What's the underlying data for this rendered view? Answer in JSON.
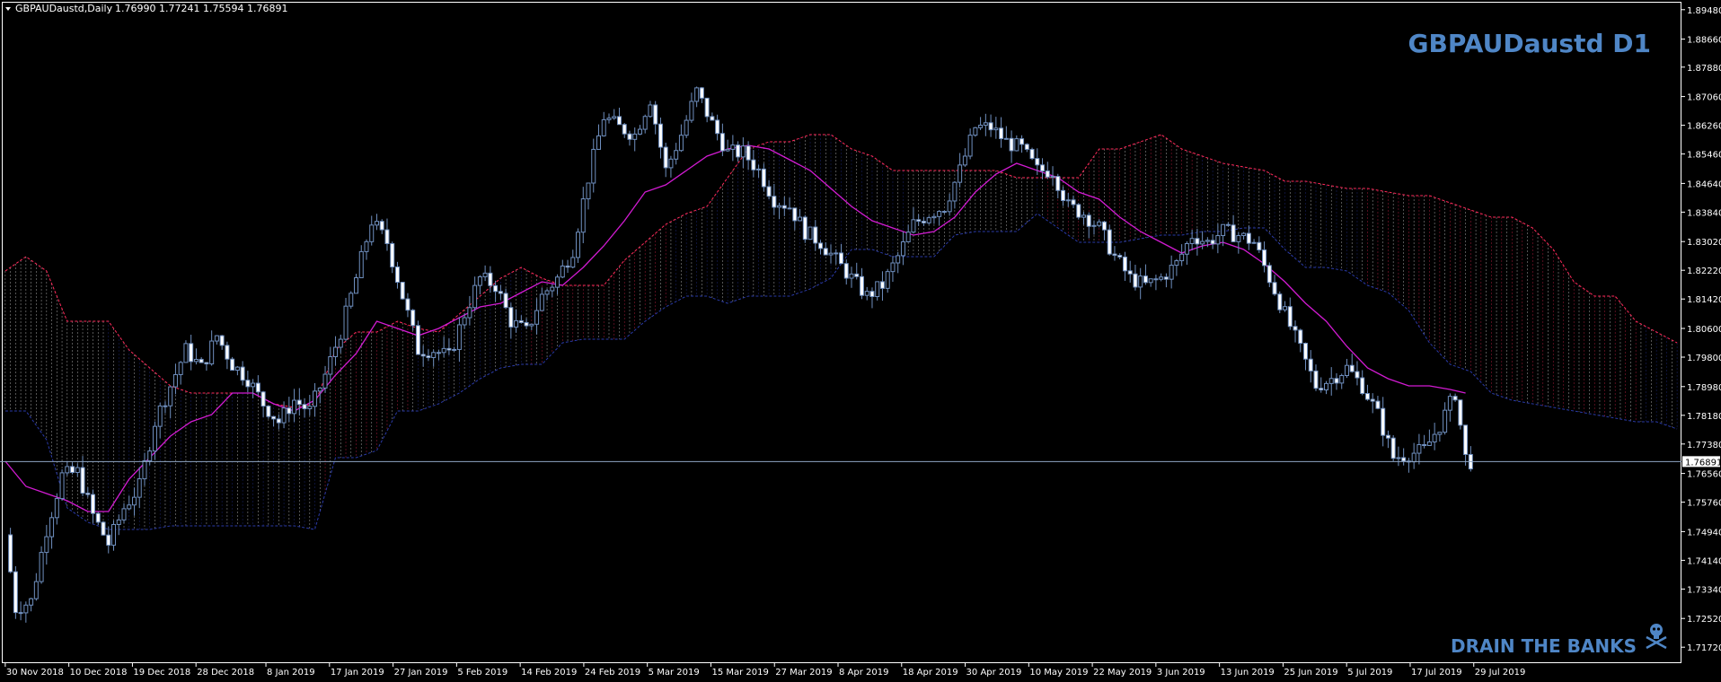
{
  "header": {
    "symbol": "GBPAUDaustd,Daily",
    "ohlc": "1.76990 1.77241 1.75594 1.76891"
  },
  "overlay": {
    "title": "GBPAUDaustd D1",
    "footer": "DRAIN THE BANKS"
  },
  "colors": {
    "background": "#000000",
    "axis": "#ffffff",
    "candle": "#ffffff",
    "wick": "#6f8fbf",
    "price_line": "#8fa6c4",
    "kijun": "#d21bd2",
    "cloud_bull": "#ffffff",
    "cloud_red": "#ff2a5a",
    "cloud_blue": "#2a3aa8",
    "brand": "#4f86c6"
  },
  "chart_data": {
    "type": "candlestick",
    "title": "GBPAUDaustd D1",
    "current_price": "1.76891",
    "ylim": [
      1.714,
      1.8955
    ],
    "y_ticks": [
      "1.89480",
      "1.88660",
      "1.87880",
      "1.87060",
      "1.86260",
      "1.85460",
      "1.84640",
      "1.83840",
      "1.83020",
      "1.82220",
      "1.81420",
      "1.80600",
      "1.79800",
      "1.78980",
      "1.78180",
      "1.77380",
      "1.76560",
      "1.75760",
      "1.74940",
      "1.74140",
      "1.73340",
      "1.72520",
      "1.71720"
    ],
    "x_ticks": [
      "30 Nov 2018",
      "10 Dec 2018",
      "19 Dec 2018",
      "28 Dec 2018",
      "8 Jan 2019",
      "17 Jan 2019",
      "27 Jan 2019",
      "5 Feb 2019",
      "14 Feb 2019",
      "24 Feb 2019",
      "5 Mar 2019",
      "15 Mar 2019",
      "27 Mar 2019",
      "8 Apr 2019",
      "18 Apr 2019",
      "30 Apr 2019",
      "10 May 2019",
      "22 May 2019",
      "3 Jun 2019",
      "13 Jun 2019",
      "25 Jun 2019",
      "5 Jul 2019",
      "17 Jul 2019",
      "29 Jul 2019"
    ],
    "close_path": [
      [
        0,
        1.7485
      ],
      [
        2,
        1.728
      ],
      [
        5,
        1.73
      ],
      [
        8,
        1.75
      ],
      [
        11,
        1.765
      ],
      [
        14,
        1.766
      ],
      [
        17,
        1.754
      ],
      [
        20,
        1.746
      ],
      [
        23,
        1.756
      ],
      [
        26,
        1.762
      ],
      [
        29,
        1.78
      ],
      [
        32,
        1.79
      ],
      [
        35,
        1.8
      ],
      [
        38,
        1.795
      ],
      [
        41,
        1.804
      ],
      [
        44,
        1.796
      ],
      [
        47,
        1.792
      ],
      [
        50,
        1.785
      ],
      [
        53,
        1.78
      ],
      [
        56,
        1.786
      ],
      [
        59,
        1.783
      ],
      [
        62,
        1.793
      ],
      [
        65,
        1.805
      ],
      [
        68,
        1.82
      ],
      [
        71,
        1.836
      ],
      [
        74,
        1.83
      ],
      [
        77,
        1.815
      ],
      [
        80,
        1.8
      ],
      [
        83,
        1.8
      ],
      [
        86,
        1.798
      ],
      [
        89,
        1.81
      ],
      [
        92,
        1.82
      ],
      [
        95,
        1.818
      ],
      [
        98,
        1.808
      ],
      [
        101,
        1.805
      ],
      [
        104,
        1.815
      ],
      [
        107,
        1.82
      ],
      [
        110,
        1.828
      ],
      [
        113,
        1.848
      ],
      [
        116,
        1.865
      ],
      [
        119,
        1.862
      ],
      [
        122,
        1.86
      ],
      [
        125,
        1.87
      ],
      [
        128,
        1.85
      ],
      [
        131,
        1.86
      ],
      [
        134,
        1.872
      ],
      [
        137,
        1.863
      ],
      [
        140,
        1.855
      ],
      [
        143,
        1.855
      ],
      [
        146,
        1.85
      ],
      [
        149,
        1.842
      ],
      [
        152,
        1.84
      ],
      [
        155,
        1.833
      ],
      [
        158,
        1.83
      ],
      [
        161,
        1.825
      ],
      [
        164,
        1.82
      ],
      [
        167,
        1.815
      ],
      [
        170,
        1.818
      ],
      [
        173,
        1.826
      ],
      [
        176,
        1.835
      ],
      [
        179,
        1.838
      ],
      [
        182,
        1.84
      ],
      [
        185,
        1.85
      ],
      [
        188,
        1.862
      ],
      [
        191,
        1.862
      ],
      [
        194,
        1.858
      ],
      [
        197,
        1.856
      ],
      [
        200,
        1.85
      ],
      [
        203,
        1.85
      ],
      [
        206,
        1.84
      ],
      [
        209,
        1.838
      ],
      [
        212,
        1.834
      ],
      [
        215,
        1.826
      ],
      [
        218,
        1.82
      ],
      [
        221,
        1.818
      ],
      [
        224,
        1.82
      ],
      [
        227,
        1.824
      ],
      [
        230,
        1.832
      ],
      [
        233,
        1.83
      ],
      [
        236,
        1.833
      ],
      [
        239,
        1.832
      ],
      [
        242,
        1.83
      ],
      [
        245,
        1.82
      ],
      [
        248,
        1.81
      ],
      [
        251,
        1.8
      ],
      [
        254,
        1.79
      ],
      [
        257,
        1.792
      ],
      [
        260,
        1.795
      ],
      [
        263,
        1.79
      ],
      [
        266,
        1.782
      ],
      [
        269,
        1.77
      ],
      [
        272,
        1.771
      ],
      [
        275,
        1.772
      ],
      [
        278,
        1.779
      ],
      [
        281,
        1.788
      ],
      [
        283,
        1.77
      ],
      [
        284,
        1.7689
      ]
    ],
    "kijun_path": [
      [
        0,
        1.769
      ],
      [
        4,
        1.762
      ],
      [
        8,
        1.76
      ],
      [
        12,
        1.758
      ],
      [
        16,
        1.755
      ],
      [
        20,
        1.755
      ],
      [
        24,
        1.764
      ],
      [
        28,
        1.77
      ],
      [
        32,
        1.776
      ],
      [
        36,
        1.78
      ],
      [
        40,
        1.782
      ],
      [
        44,
        1.788
      ],
      [
        48,
        1.788
      ],
      [
        52,
        1.785
      ],
      [
        56,
        1.783
      ],
      [
        60,
        1.786
      ],
      [
        64,
        1.793
      ],
      [
        68,
        1.799
      ],
      [
        72,
        1.808
      ],
      [
        76,
        1.806
      ],
      [
        80,
        1.804
      ],
      [
        84,
        1.806
      ],
      [
        88,
        1.809
      ],
      [
        92,
        1.812
      ],
      [
        96,
        1.813
      ],
      [
        100,
        1.816
      ],
      [
        104,
        1.819
      ],
      [
        108,
        1.818
      ],
      [
        112,
        1.823
      ],
      [
        116,
        1.829
      ],
      [
        120,
        1.836
      ],
      [
        124,
        1.844
      ],
      [
        128,
        1.846
      ],
      [
        132,
        1.85
      ],
      [
        136,
        1.854
      ],
      [
        140,
        1.856
      ],
      [
        144,
        1.857
      ],
      [
        148,
        1.856
      ],
      [
        152,
        1.853
      ],
      [
        156,
        1.85
      ],
      [
        160,
        1.845
      ],
      [
        164,
        1.84
      ],
      [
        168,
        1.836
      ],
      [
        172,
        1.834
      ],
      [
        176,
        1.832
      ],
      [
        180,
        1.833
      ],
      [
        184,
        1.837
      ],
      [
        188,
        1.844
      ],
      [
        192,
        1.849
      ],
      [
        196,
        1.852
      ],
      [
        200,
        1.85
      ],
      [
        204,
        1.848
      ],
      [
        208,
        1.844
      ],
      [
        212,
        1.842
      ],
      [
        216,
        1.837
      ],
      [
        220,
        1.833
      ],
      [
        224,
        1.83
      ],
      [
        228,
        1.827
      ],
      [
        232,
        1.829
      ],
      [
        236,
        1.83
      ],
      [
        240,
        1.828
      ],
      [
        244,
        1.824
      ],
      [
        248,
        1.819
      ],
      [
        252,
        1.813
      ],
      [
        256,
        1.808
      ],
      [
        260,
        1.801
      ],
      [
        264,
        1.795
      ],
      [
        268,
        1.792
      ],
      [
        272,
        1.79
      ],
      [
        276,
        1.79
      ],
      [
        280,
        1.789
      ],
      [
        283,
        1.788
      ]
    ],
    "cloud_top": [
      [
        0,
        1.822
      ],
      [
        4,
        1.826
      ],
      [
        8,
        1.822
      ],
      [
        12,
        1.808
      ],
      [
        16,
        1.808
      ],
      [
        20,
        1.808
      ],
      [
        24,
        1.8
      ],
      [
        28,
        1.795
      ],
      [
        32,
        1.79
      ],
      [
        36,
        1.788
      ],
      [
        40,
        1.788
      ],
      [
        44,
        1.788
      ],
      [
        48,
        1.788
      ],
      [
        52,
        1.785
      ],
      [
        56,
        1.784
      ],
      [
        60,
        1.785
      ],
      [
        64,
        1.8
      ],
      [
        68,
        1.805
      ],
      [
        72,
        1.805
      ],
      [
        76,
        1.808
      ],
      [
        80,
        1.806
      ],
      [
        84,
        1.805
      ],
      [
        88,
        1.81
      ],
      [
        92,
        1.815
      ],
      [
        96,
        1.82
      ],
      [
        100,
        1.823
      ],
      [
        104,
        1.82
      ],
      [
        108,
        1.818
      ],
      [
        112,
        1.818
      ],
      [
        116,
        1.818
      ],
      [
        120,
        1.825
      ],
      [
        124,
        1.83
      ],
      [
        128,
        1.835
      ],
      [
        132,
        1.838
      ],
      [
        136,
        1.84
      ],
      [
        140,
        1.848
      ],
      [
        144,
        1.856
      ],
      [
        148,
        1.858
      ],
      [
        152,
        1.858
      ],
      [
        156,
        1.86
      ],
      [
        160,
        1.86
      ],
      [
        164,
        1.856
      ],
      [
        168,
        1.854
      ],
      [
        172,
        1.85
      ],
      [
        176,
        1.85
      ],
      [
        180,
        1.85
      ],
      [
        184,
        1.85
      ],
      [
        188,
        1.85
      ],
      [
        192,
        1.85
      ],
      [
        196,
        1.848
      ],
      [
        200,
        1.848
      ],
      [
        204,
        1.848
      ],
      [
        208,
        1.848
      ],
      [
        212,
        1.856
      ],
      [
        216,
        1.856
      ],
      [
        220,
        1.858
      ],
      [
        224,
        1.86
      ],
      [
        228,
        1.856
      ],
      [
        232,
        1.854
      ],
      [
        236,
        1.852
      ],
      [
        240,
        1.851
      ],
      [
        244,
        1.85
      ],
      [
        248,
        1.847
      ],
      [
        252,
        1.847
      ],
      [
        256,
        1.846
      ],
      [
        260,
        1.845
      ],
      [
        264,
        1.845
      ],
      [
        268,
        1.844
      ],
      [
        272,
        1.843
      ],
      [
        276,
        1.843
      ],
      [
        280,
        1.841
      ],
      [
        284,
        1.839
      ],
      [
        288,
        1.837
      ],
      [
        292,
        1.837
      ],
      [
        296,
        1.834
      ],
      [
        300,
        1.828
      ],
      [
        304,
        1.819
      ],
      [
        308,
        1.815
      ],
      [
        312,
        1.815
      ],
      [
        316,
        1.808
      ],
      [
        320,
        1.805
      ],
      [
        324,
        1.802
      ]
    ],
    "cloud_bottom": [
      [
        0,
        1.783
      ],
      [
        4,
        1.783
      ],
      [
        8,
        1.775
      ],
      [
        12,
        1.756
      ],
      [
        16,
        1.752
      ],
      [
        20,
        1.75
      ],
      [
        24,
        1.75
      ],
      [
        28,
        1.75
      ],
      [
        32,
        1.751
      ],
      [
        36,
        1.751
      ],
      [
        40,
        1.751
      ],
      [
        44,
        1.751
      ],
      [
        48,
        1.751
      ],
      [
        52,
        1.751
      ],
      [
        56,
        1.751
      ],
      [
        60,
        1.75
      ],
      [
        64,
        1.77
      ],
      [
        68,
        1.77
      ],
      [
        72,
        1.772
      ],
      [
        76,
        1.783
      ],
      [
        80,
        1.783
      ],
      [
        84,
        1.785
      ],
      [
        88,
        1.788
      ],
      [
        92,
        1.792
      ],
      [
        96,
        1.795
      ],
      [
        100,
        1.796
      ],
      [
        104,
        1.796
      ],
      [
        108,
        1.802
      ],
      [
        112,
        1.803
      ],
      [
        116,
        1.803
      ],
      [
        120,
        1.803
      ],
      [
        124,
        1.808
      ],
      [
        128,
        1.812
      ],
      [
        132,
        1.815
      ],
      [
        136,
        1.815
      ],
      [
        140,
        1.813
      ],
      [
        144,
        1.815
      ],
      [
        148,
        1.815
      ],
      [
        152,
        1.815
      ],
      [
        156,
        1.817
      ],
      [
        160,
        1.82
      ],
      [
        164,
        1.828
      ],
      [
        168,
        1.828
      ],
      [
        172,
        1.826
      ],
      [
        176,
        1.826
      ],
      [
        180,
        1.826
      ],
      [
        184,
        1.832
      ],
      [
        188,
        1.833
      ],
      [
        192,
        1.833
      ],
      [
        196,
        1.833
      ],
      [
        200,
        1.838
      ],
      [
        204,
        1.834
      ],
      [
        208,
        1.83
      ],
      [
        212,
        1.83
      ],
      [
        216,
        1.83
      ],
      [
        220,
        1.831
      ],
      [
        224,
        1.832
      ],
      [
        228,
        1.832
      ],
      [
        232,
        1.833
      ],
      [
        236,
        1.833
      ],
      [
        240,
        1.834
      ],
      [
        244,
        1.834
      ],
      [
        248,
        1.828
      ],
      [
        252,
        1.823
      ],
      [
        256,
        1.823
      ],
      [
        260,
        1.822
      ],
      [
        264,
        1.818
      ],
      [
        268,
        1.816
      ],
      [
        272,
        1.811
      ],
      [
        276,
        1.802
      ],
      [
        280,
        1.796
      ],
      [
        284,
        1.794
      ],
      [
        288,
        1.788
      ],
      [
        292,
        1.786
      ],
      [
        296,
        1.785
      ],
      [
        300,
        1.784
      ],
      [
        304,
        1.783
      ],
      [
        308,
        1.782
      ],
      [
        312,
        1.781
      ],
      [
        316,
        1.78
      ],
      [
        320,
        1.78
      ],
      [
        324,
        1.778
      ]
    ]
  }
}
